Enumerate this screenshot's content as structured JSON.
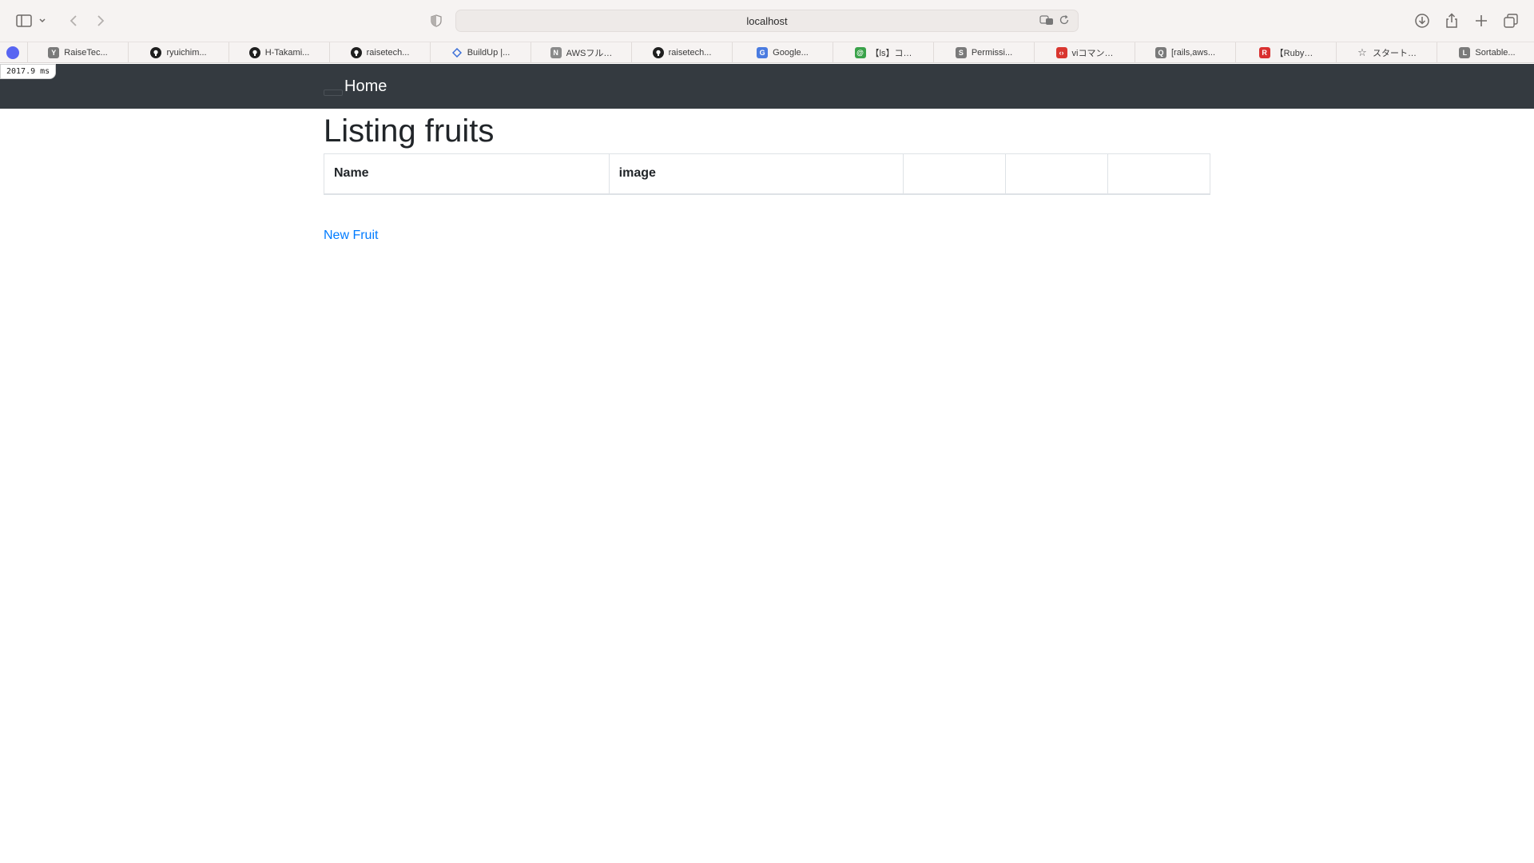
{
  "browser": {
    "url": "localhost",
    "favorites": [
      {
        "label": "RaiseTec...",
        "icon": "raisetech-y-icon",
        "color": "#7a7a7a",
        "glyph": "Y"
      },
      {
        "label": "ryuichim...",
        "icon": "github-icon",
        "color": "#1f1f1f",
        "glyph": ""
      },
      {
        "label": "H-Takami...",
        "icon": "github-icon",
        "color": "#1f1f1f",
        "glyph": ""
      },
      {
        "label": "raisetech...",
        "icon": "github-icon",
        "color": "#1f1f1f",
        "glyph": ""
      },
      {
        "label": "BuildUp |...",
        "icon": "buildup-icon",
        "color": "#3b6fd8",
        "glyph": ""
      },
      {
        "label": "AWSフル…",
        "icon": "notion-n-icon",
        "color": "#8a8a8a",
        "glyph": "N"
      },
      {
        "label": "raisetech...",
        "icon": "github-icon",
        "color": "#1f1f1f",
        "glyph": ""
      },
      {
        "label": "Google...",
        "icon": "google-translate-icon",
        "color": "#4a7be0",
        "glyph": "G"
      },
      {
        "label": "【ls】コ…",
        "icon": "at-sign-icon",
        "color": "#3aa24a",
        "glyph": "@"
      },
      {
        "label": "Permissi...",
        "icon": "s-icon",
        "color": "#7a7a7a",
        "glyph": "S"
      },
      {
        "label": "viコマン…",
        "icon": "code-icon",
        "color": "#d9362f",
        "glyph": "‹›"
      },
      {
        "label": "[rails,aws...",
        "icon": "qiita-icon",
        "color": "#7a7a7a",
        "glyph": "Q"
      },
      {
        "label": "【Ruby…",
        "icon": "ruby-icon",
        "color": "#d93030",
        "glyph": "R"
      },
      {
        "label": "スタート…",
        "icon": "star-icon",
        "color": "#ffffff",
        "glyph": "☆"
      },
      {
        "label": "Sortable...",
        "icon": "l-icon",
        "color": "#7a7a7a",
        "glyph": "L"
      }
    ]
  },
  "timing_badge": "2017.9 ms",
  "navbar": {
    "brand": "Home"
  },
  "page": {
    "title": "Listing fruits",
    "table": {
      "headers": [
        "Name",
        "image",
        "",
        "",
        ""
      ]
    },
    "new_link": "New Fruit"
  },
  "colors": {
    "navbar_bg": "#343a40",
    "link": "#007bff"
  }
}
